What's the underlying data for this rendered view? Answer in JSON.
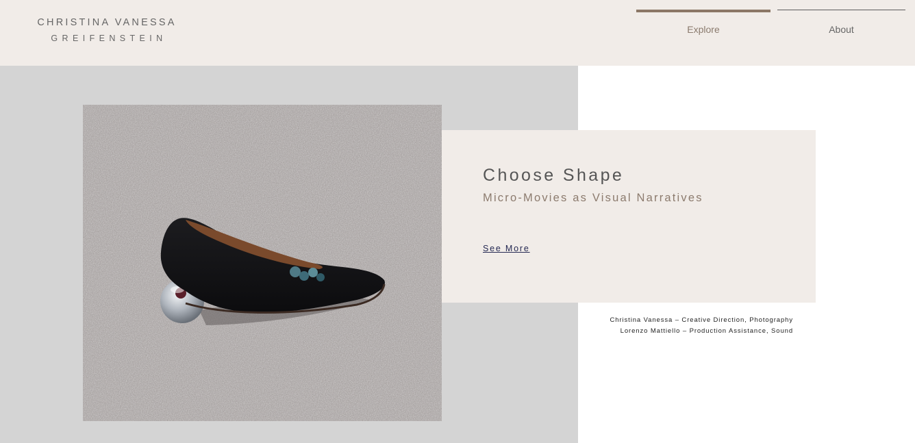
{
  "header": {
    "logo_line1": "CHRISTINA VANESSA",
    "logo_line2": "GREIFENSTEIN",
    "nav": [
      {
        "label": "Explore",
        "active": true
      },
      {
        "label": "About",
        "active": false
      }
    ]
  },
  "feature": {
    "title": "Choose Shape",
    "subtitle": "Micro-Movies as Visual Narratives",
    "link_label": "See More"
  },
  "credits": [
    "Christina Vanessa – Creative Direction, Photography",
    "Lorenzo Mattiello – Production Assistance, Sound"
  ],
  "colors": {
    "header_bg": "#f1ece8",
    "left_panel_bg": "#d4d4d4",
    "card_bg": "#f1ece8",
    "accent": "#8c7766",
    "link": "#242852"
  }
}
